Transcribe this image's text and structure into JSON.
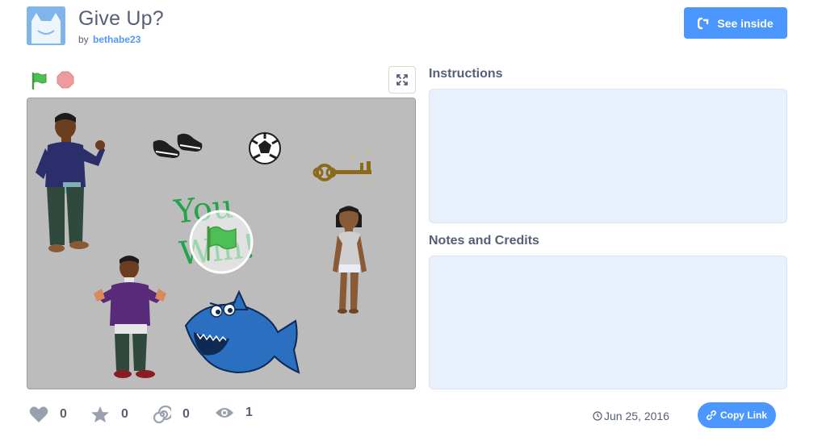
{
  "project": {
    "title": "Give Up?",
    "by_prefix": "by",
    "author": "bethabe23"
  },
  "header": {
    "see_inside_label": "See inside"
  },
  "player": {
    "flag_icon": "green-flag-icon",
    "stop_icon": "stop-icon",
    "fullscreen_icon": "fullscreen-icon",
    "stage_text": "You Win!"
  },
  "sections": {
    "instructions_label": "Instructions",
    "instructions_text": "",
    "notes_label": "Notes and Credits",
    "notes_text": ""
  },
  "stats": {
    "loves": "0",
    "favorites": "0",
    "remixes": "0",
    "views": "1"
  },
  "footer": {
    "date": "Jun 25, 2016",
    "copy_link_label": "Copy Link"
  },
  "colors": {
    "accent": "#4c97ff",
    "text": "#575e75",
    "stage_bg": "#bcbcbc",
    "box_bg": "#e9f1fc",
    "flag_green": "#4cbf56",
    "stop_red": "#ec9c9c"
  }
}
